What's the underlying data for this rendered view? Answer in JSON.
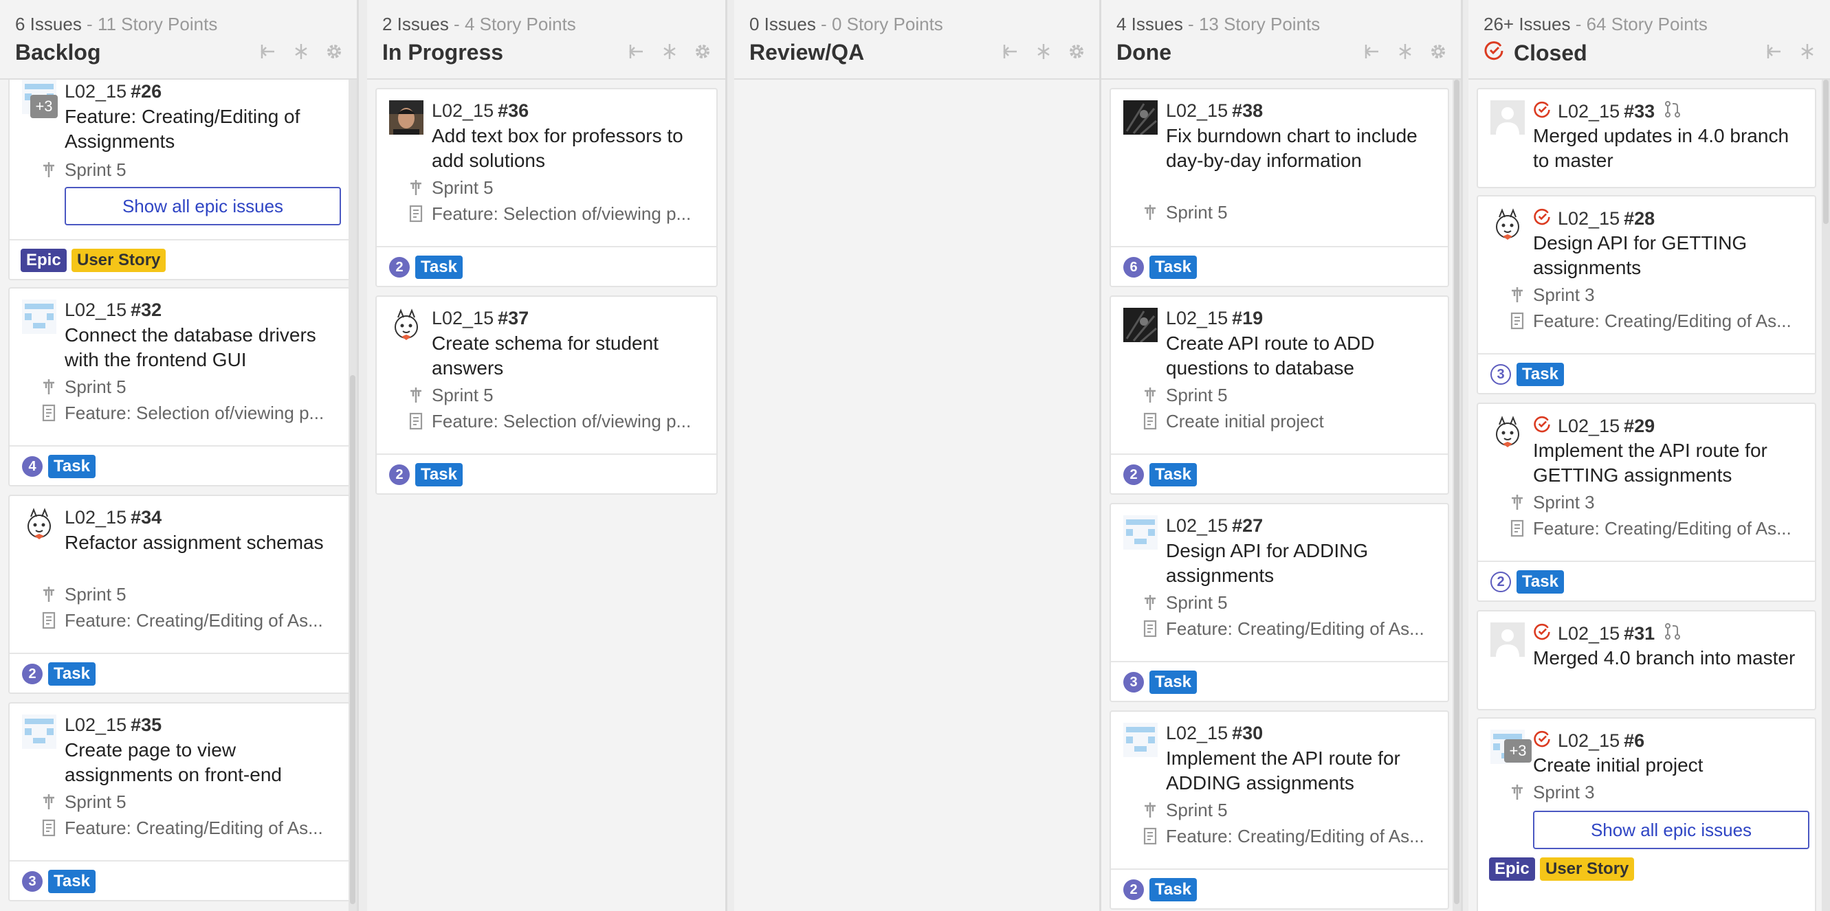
{
  "columns": [
    {
      "id": "backlog",
      "count": "6 Issues",
      "points": "11 Story Points",
      "title": "Backlog",
      "cards": [
        {
          "project": "L02_15",
          "number": "#26",
          "title": "Feature: Creating/Editing of Assignments",
          "sprint": "Sprint 5",
          "avatar_extra": "+3",
          "epic_button": "Show all epic issues",
          "labels": [
            "Epic",
            "User Story"
          ]
        },
        {
          "project": "L02_15",
          "number": "#32",
          "title": "Connect the database drivers with the frontend GUI",
          "sprint": "Sprint 5",
          "epic": "Feature: Selection of/viewing p...",
          "weight": "4",
          "label": "Task"
        },
        {
          "project": "L02_15",
          "number": "#34",
          "title": "Refactor assignment schemas",
          "sprint": "Sprint 5",
          "epic": "Feature: Creating/Editing of As...",
          "weight": "2",
          "label": "Task"
        },
        {
          "project": "L02_15",
          "number": "#35",
          "title": "Create page to view assignments on front-end",
          "sprint": "Sprint 5",
          "epic": "Feature: Creating/Editing of As...",
          "weight": "3",
          "label": "Task"
        }
      ]
    },
    {
      "id": "in-progress",
      "count": "2 Issues",
      "points": "4 Story Points",
      "title": "In Progress",
      "cards": [
        {
          "project": "L02_15",
          "number": "#36",
          "title": "Add text box for professors to add solutions",
          "sprint": "Sprint 5",
          "epic": "Feature: Selection of/viewing p...",
          "weight": "2",
          "label": "Task"
        },
        {
          "project": "L02_15",
          "number": "#37",
          "title": "Create schema for student answers",
          "sprint": "Sprint 5",
          "epic": "Feature: Selection of/viewing p...",
          "weight": "2",
          "label": "Task"
        }
      ]
    },
    {
      "id": "review-qa",
      "count": "0 Issues",
      "points": "0 Story Points",
      "title": "Review/QA",
      "cards": []
    },
    {
      "id": "done",
      "count": "4 Issues",
      "points": "13 Story Points",
      "title": "Done",
      "cards": [
        {
          "project": "L02_15",
          "number": "#38",
          "title": "Fix burndown chart to include day-by-day information",
          "sprint": "Sprint 5",
          "weight": "6",
          "label": "Task"
        },
        {
          "project": "L02_15",
          "number": "#19",
          "title": "Create API route to ADD questions to database",
          "sprint": "Sprint 5",
          "epic": "Create initial project",
          "weight": "2",
          "label": "Task"
        },
        {
          "project": "L02_15",
          "number": "#27",
          "title": "Design API for ADDING assignments",
          "sprint": "Sprint 5",
          "epic": "Feature: Creating/Editing of As...",
          "weight": "3",
          "label": "Task"
        },
        {
          "project": "L02_15",
          "number": "#30",
          "title": "Implement the API route for ADDING assignments",
          "sprint": "Sprint 5",
          "epic": "Feature: Creating/Editing of As...",
          "weight": "2",
          "label": "Task"
        }
      ]
    },
    {
      "id": "closed",
      "count": "26+ Issues",
      "points": "64 Story Points",
      "title": "Closed",
      "cards": [
        {
          "project": "L02_15",
          "number": "#33",
          "title": "Merged updates in 4.0 branch to master"
        },
        {
          "project": "L02_15",
          "number": "#28",
          "title": "Design API for GETTING assignments",
          "sprint": "Sprint 3",
          "epic": "Feature: Creating/Editing of As...",
          "weight": "3",
          "label": "Task"
        },
        {
          "project": "L02_15",
          "number": "#29",
          "title": "Implement the API route for GETTING assignments",
          "sprint": "Sprint 3",
          "epic": "Feature: Creating/Editing of As...",
          "weight": "2",
          "label": "Task"
        },
        {
          "project": "L02_15",
          "number": "#31",
          "title": "Merged 4.0 branch into master"
        },
        {
          "project": "L02_15",
          "number": "#6",
          "title": "Create initial project",
          "sprint": "Sprint 3",
          "avatar_extra": "+3",
          "epic_button": "Show all epic issues",
          "labels": [
            "Epic",
            "User Story"
          ]
        }
      ]
    }
  ],
  "separator": " - ",
  "colors": {
    "task": "#1f78d1",
    "epic": "#44449a",
    "user_story": "#f5c518",
    "closed": "#db3b21",
    "weight": "#6a6ac0"
  },
  "icons": {
    "sprint": "milestone-icon",
    "epic": "epic-icon",
    "closed": "closed-issue-icon",
    "merge": "merge-request-icon"
  }
}
